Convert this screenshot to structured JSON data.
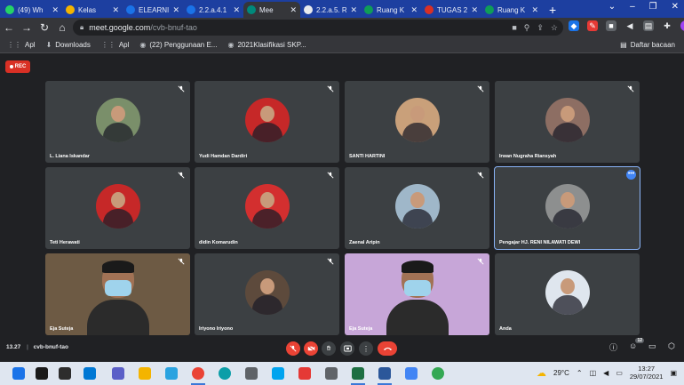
{
  "browser": {
    "tabs": [
      {
        "title": "(49) Wh",
        "color": "#25d366"
      },
      {
        "title": "Kelas",
        "color": "#f4b400"
      },
      {
        "title": "ELEARNI",
        "color": "#1a73e8"
      },
      {
        "title": "2.2.a.4.1",
        "color": "#1a73e8"
      },
      {
        "title": "Mee",
        "color": "#00897b",
        "active": true
      },
      {
        "title": "2.2.a.5. R",
        "color": "#e8eaed"
      },
      {
        "title": "Ruang K",
        "color": "#0f9d58"
      },
      {
        "title": "TUGAS 2",
        "color": "#d93025"
      },
      {
        "title": "Ruang K",
        "color": "#0f9d58"
      }
    ],
    "new_tab": "+",
    "url_host": "meet.google.com",
    "url_path": "/cvb-bnuf-tao",
    "bookmarks": [
      {
        "label": "Apl",
        "icon": "apps-grid-icon"
      },
      {
        "label": "Downloads",
        "icon": "download-icon"
      },
      {
        "label": "Apl",
        "icon": "apps-grid-icon"
      },
      {
        "label": "(22) Penggunaan E...",
        "icon": "globe-icon"
      },
      {
        "label": "2021Klasifikasi SKP...",
        "icon": "globe-icon"
      }
    ],
    "reading_list": "Daftar bacaan"
  },
  "meet": {
    "rec_label": "REC",
    "participants": [
      {
        "name": "L. Liana Iskandar",
        "bg": "#7a8f6a"
      },
      {
        "name": "Yudi Hamdan Dardiri",
        "bg": "#c62828"
      },
      {
        "name": "SANTI HARTINI",
        "bg": "#c9a07a"
      },
      {
        "name": "Irwan Nugraha Riansyah",
        "bg": "#8d6e63"
      },
      {
        "name": "Teti Herawati",
        "bg": "#c62828"
      },
      {
        "name": "didin Komarudin",
        "bg": "#d32f2f"
      },
      {
        "name": "Zaenal Aripin",
        "bg": "#9fb7c9"
      },
      {
        "name": "Pengajar HJ. RENI NILAWATI DEWI",
        "bg": "#8d8f8f"
      },
      {
        "name": "Eja Suteja",
        "bg": "#6d5a44"
      },
      {
        "name": "Iriyono Iriyono",
        "bg": "#5d4a3c"
      },
      {
        "name": "Eja Suteja",
        "bg": "#c7a6d8"
      },
      {
        "name": "Anda",
        "bg": "#dfe6ee"
      }
    ],
    "time": "13.27",
    "meeting_code": "cvb-bnuf-tao",
    "participant_count": "12"
  },
  "taskbar": {
    "temperature": "29°C",
    "time": "13:27",
    "date": "29/07/2021"
  }
}
